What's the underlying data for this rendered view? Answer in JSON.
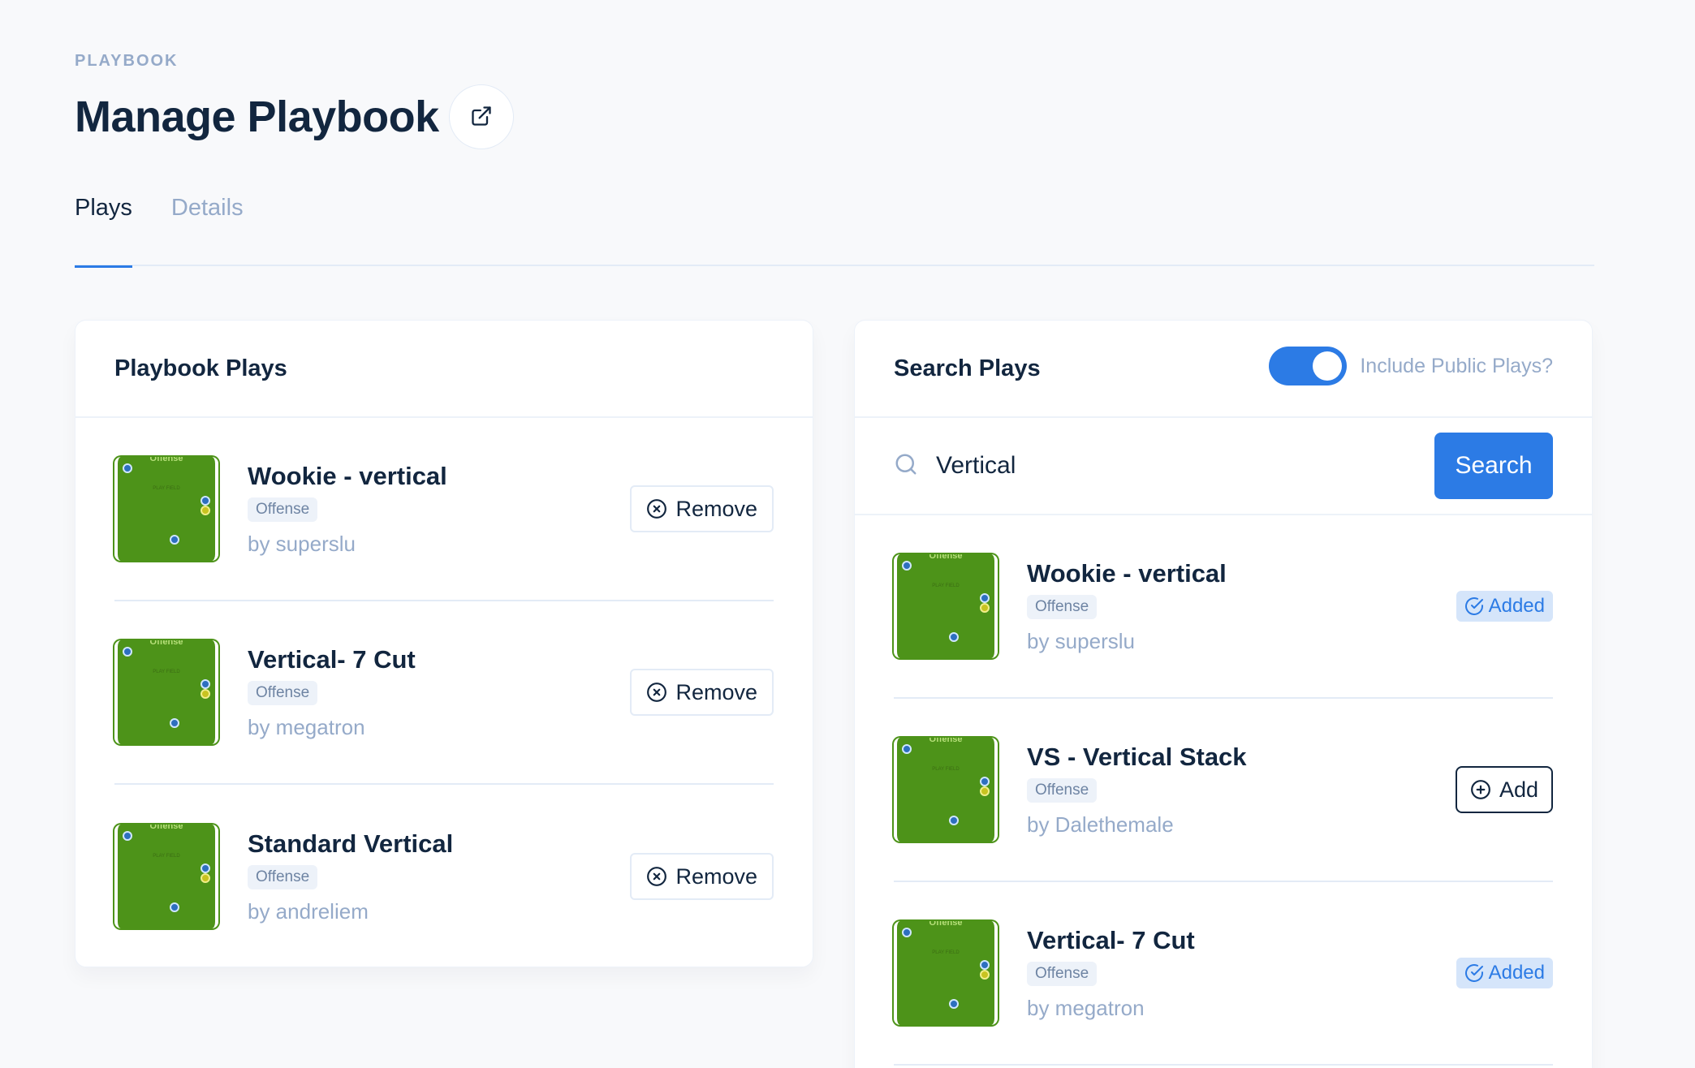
{
  "header": {
    "eyebrow": "PLAYBOOK",
    "title": "Manage Playbook"
  },
  "tabs": [
    {
      "label": "Plays",
      "active": true
    },
    {
      "label": "Details",
      "active": false
    }
  ],
  "playbook_plays": {
    "title": "Playbook Plays",
    "remove_label": "Remove",
    "items": [
      {
        "title": "Wookie - vertical",
        "tag": "Offense",
        "author": "by superslu"
      },
      {
        "title": "Vertical- 7 Cut",
        "tag": "Offense",
        "author": "by megatron"
      },
      {
        "title": "Standard Vertical",
        "tag": "Offense",
        "author": "by andreliem"
      }
    ]
  },
  "search_plays": {
    "title": "Search Plays",
    "toggle_label": "Include Public Plays?",
    "toggle_on": true,
    "search_value": "Vertical",
    "search_button": "Search",
    "added_label": "Added",
    "add_label": "Add",
    "items": [
      {
        "title": "Wookie - vertical",
        "tag": "Offense",
        "author": "by superslu",
        "status": "added"
      },
      {
        "title": "VS - Vertical Stack",
        "tag": "Offense",
        "author": "by Dalethemale",
        "status": "add"
      },
      {
        "title": "Vertical- 7 Cut",
        "tag": "Offense",
        "author": "by megatron",
        "status": "added"
      }
    ]
  },
  "thumbnail": {
    "header": "Offense",
    "field_label": "PLAY FIELD"
  },
  "colors": {
    "accent": "#2c7be5",
    "field": "#4d9319",
    "text": "#12263f",
    "muted": "#95aac9"
  }
}
